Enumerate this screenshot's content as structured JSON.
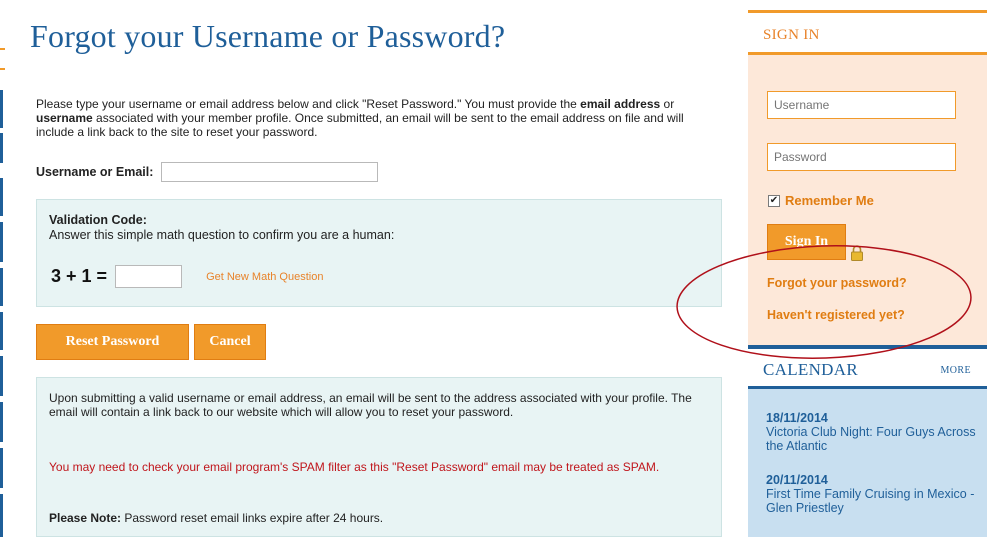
{
  "page": {
    "title": "Forgot your Username or Password?",
    "intro": [
      "Please type your username or email address below and click \"Reset Password.\" You must provide the ",
      "email address",
      " or ",
      "username",
      " associated with your member profile. Once submitted, an email will be sent to the email address on file and will include a link back to the site to reset your password."
    ],
    "username_label": "Username or Email:",
    "username_value": ""
  },
  "validation": {
    "title": "Validation Code:",
    "subtitle": "Answer this simple math question to confirm you are a human:",
    "question": "3 + 1 =",
    "answer_value": "",
    "new_question_link": "Get New Math Question"
  },
  "buttons": {
    "reset": "Reset Password",
    "cancel": "Cancel"
  },
  "notice": {
    "info": "Upon submitting a valid username or email address, an email will be sent to the address associated with your profile. The email will contain a link back to our website which will allow you to reset your password.",
    "warning": "You may need to check your email program's SPAM filter as this \"Reset Password\" email may be treated as SPAM.",
    "note_label": "Please Note:",
    "note_text": " Password reset email links expire after 24 hours."
  },
  "sidebar": {
    "signin": {
      "title": "SIGN IN",
      "username_placeholder": "Username",
      "password_placeholder": "Password",
      "remember_label": "Remember Me",
      "remember_checked": true,
      "button": "Sign In",
      "forgot_link": "Forgot your password?",
      "register_link": "Haven't registered yet?"
    },
    "calendar": {
      "title": "CALENDAR",
      "more": "MORE",
      "events": [
        {
          "date": "18/11/2014",
          "name": "Victoria Club Night: Four Guys Across the Atlantic"
        },
        {
          "date": "20/11/2014",
          "name": "First Time Family Cruising in Mexico - Glen Priestley"
        }
      ]
    }
  },
  "colors": {
    "brand_blue": "#1f5f99",
    "accent_orange": "#f19a2a",
    "panel_teal": "#e8f4f4",
    "signin_bg": "#fde8d9",
    "warning_red": "#c0161c",
    "annotation_red": "#b0101a"
  },
  "icons": {
    "lock": "lock-icon",
    "checkbox": "checkbox-checked-icon"
  }
}
